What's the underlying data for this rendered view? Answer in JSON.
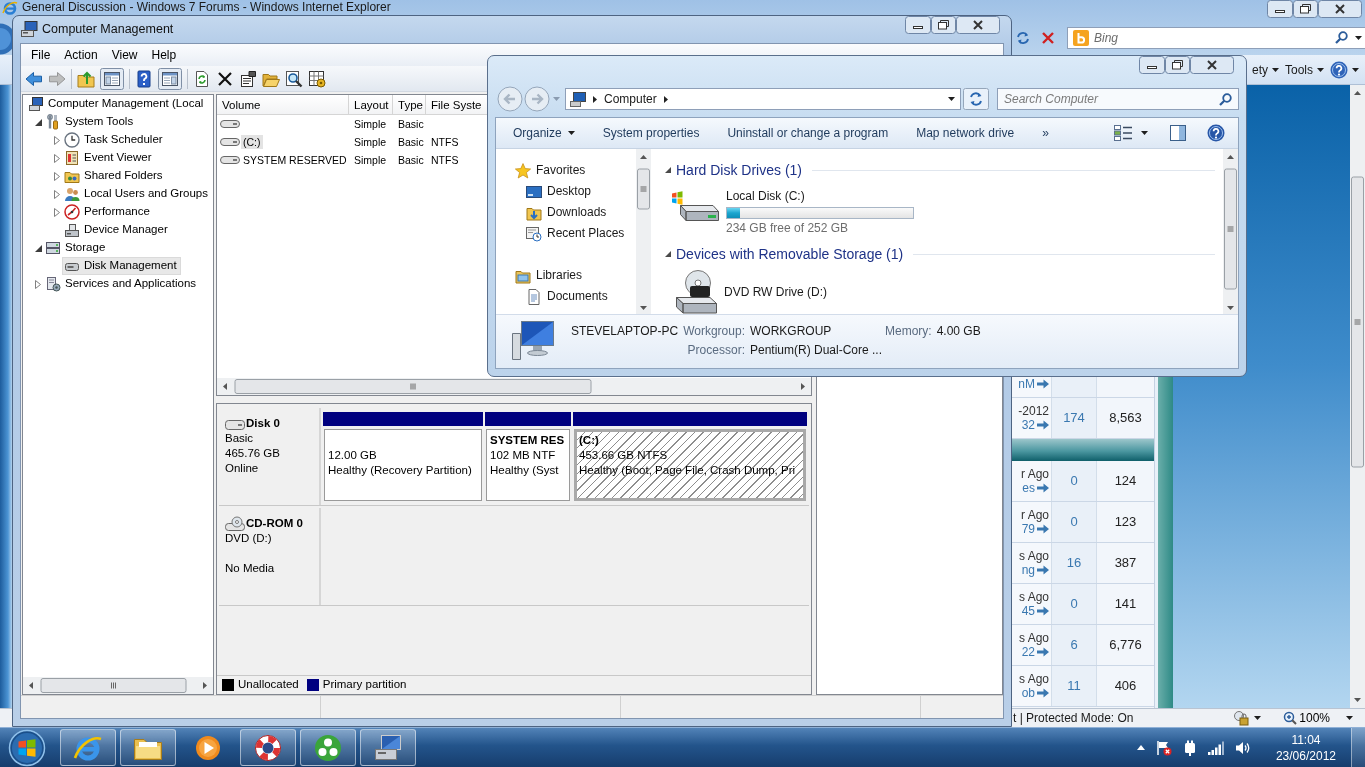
{
  "browser": {
    "title": "General Discussion - Windows 7 Forums - Windows Internet Explorer",
    "search": {
      "placeholder": "Bing"
    },
    "command_bar": [
      {
        "label": "ety",
        "menu": true
      },
      {
        "label": "Tools",
        "menu": true
      }
    ],
    "forum_rows": [
      {
        "kind": "thread",
        "column_1": [
          "nM"
        ]
      },
      {
        "kind": "thread",
        "column_1": [
          "-2012",
          "32"
        ],
        "column_2": "174",
        "column_3": "8,563"
      },
      {
        "kind": "section"
      },
      {
        "kind": "thread",
        "column_1": [
          "r Ago",
          "es"
        ],
        "column_2": "0",
        "column_3": "124"
      },
      {
        "kind": "thread",
        "column_1": [
          "r Ago",
          "79"
        ],
        "column_2": "0",
        "column_3": "123"
      },
      {
        "kind": "thread",
        "column_1": [
          "s Ago",
          "ng"
        ],
        "column_2": "16",
        "column_3": "387"
      },
      {
        "kind": "thread",
        "column_1": [
          "s Ago",
          "45"
        ],
        "column_2": "0",
        "column_3": "141"
      },
      {
        "kind": "thread",
        "column_1": [
          "s Ago",
          "22"
        ],
        "column_2": "6",
        "column_3": "6,776"
      },
      {
        "kind": "thread",
        "column_1": [
          "s Ago",
          "ob"
        ],
        "column_2": "11",
        "column_3": "406"
      }
    ],
    "status_bar": {
      "text": "t | Protected Mode: On",
      "zoom": "100%"
    }
  },
  "computer_management": {
    "title": "Computer Management",
    "menu": [
      "File",
      "Action",
      "View",
      "Help"
    ],
    "toolbar": [
      [
        {
          "pressed": false,
          "disabled": false
        },
        {
          "pressed": false,
          "disabled": true
        }
      ],
      [
        {
          "pressed": false,
          "disabled": false
        },
        {
          "pressed": true,
          "disabled": false
        }
      ],
      [
        {
          "pressed": false,
          "disabled": false
        },
        {
          "pressed": true,
          "disabled": false
        }
      ],
      [
        {
          "pressed": false,
          "disabled": false
        },
        {
          "pressed": false,
          "disabled": false
        },
        {
          "pressed": false,
          "disabled": false
        },
        {
          "pressed": false,
          "disabled": false
        },
        {
          "pressed": false,
          "disabled": false
        },
        {
          "pressed": false,
          "disabled": false
        }
      ]
    ],
    "tree": [
      {
        "label": "Computer Management (Local",
        "selected": false,
        "children": [
          {
            "label": "System Tools",
            "expanded": true,
            "selected": false,
            "children": [
              {
                "label": "Task Scheduler",
                "expanded": false,
                "selected": false
              },
              {
                "label": "Event Viewer",
                "expanded": false,
                "selected": false
              },
              {
                "label": "Shared Folders",
                "expanded": false,
                "selected": false
              },
              {
                "label": "Local Users and Groups",
                "expanded": false,
                "selected": false
              },
              {
                "label": "Performance",
                "expanded": false,
                "selected": false
              },
              {
                "label": "Device Manager",
                "selected": false
              }
            ]
          },
          {
            "label": "Storage",
            "expanded": true,
            "selected": false,
            "children": [
              {
                "label": "Disk Management",
                "selected": true
              }
            ]
          },
          {
            "label": "Services and Applications",
            "expanded": false,
            "selected": false
          }
        ]
      }
    ],
    "volume_list": {
      "columns": [
        "Volume",
        "Layout",
        "Type",
        "File Syste"
      ],
      "rows": [
        {
          "layout": "Simple",
          "type": "Basic",
          "selected": false
        },
        {
          "volume": "(C:)",
          "layout": "Simple",
          "type": "Basic",
          "file_system": "NTFS",
          "selected": true
        },
        {
          "volume": "SYSTEM RESERVED",
          "layout": "Simple",
          "type": "Basic",
          "file_system": "NTFS",
          "selected": false
        }
      ]
    },
    "disks": [
      {
        "kind": "disk",
        "name": "Disk 0",
        "type": "Basic",
        "size": "465.76 GB",
        "status": "Online",
        "partitions": [
          {
            "kind": "primary",
            "lines": [
              "12.00 GB",
              "Healthy (Recovery Partition)"
            ],
            "selected": false
          },
          {
            "kind": "primary",
            "name": "SYSTEM RES",
            "lines": [
              "102 MB NTF",
              "Healthy (Syst"
            ],
            "selected": false
          },
          {
            "kind": "primary",
            "name": "(C:)",
            "lines": [
              "453.66 GB NTFS",
              "Healthy (Boot, Page File, Crash Dump, Pri"
            ],
            "selected": true
          }
        ]
      },
      {
        "kind": "cdrom",
        "name": "CD-ROM 0",
        "type": "DVD (D:)",
        "status": "No Media"
      }
    ],
    "legend": [
      {
        "label": "Unallocated",
        "color": "#000000"
      },
      {
        "label": "Primary partition",
        "color": "#000080"
      }
    ]
  },
  "explorer": {
    "navigation": [
      {
        "disabled": true
      },
      {
        "disabled": true
      }
    ],
    "address": [
      "Computer"
    ],
    "search": {
      "placeholder": "Search Computer"
    },
    "toolbar": [
      {
        "label": "Organize",
        "menu": true
      },
      {
        "label": "System properties",
        "menu": false
      },
      {
        "label": "Uninstall or change a program",
        "menu": false
      },
      {
        "label": "Map network drive",
        "menu": false
      },
      {
        "label": "»",
        "menu": false
      }
    ],
    "nav_pane": [
      {
        "label": "Favorites",
        "children": [
          {
            "label": "Desktop"
          },
          {
            "label": "Downloads"
          },
          {
            "label": "Recent Places"
          }
        ]
      },
      {
        "label": "Libraries",
        "children": [
          {
            "label": "Documents"
          }
        ]
      }
    ],
    "groups": [
      {
        "title": "Hard Disk Drives (1)",
        "expanded": true,
        "items": [
          {
            "kind": "hard_disk",
            "name": "Local Disk (C:)",
            "level": 0.07,
            "caption": "234 GB free of 252 GB"
          }
        ]
      },
      {
        "title": "Devices with Removable Storage (1)",
        "expanded": true,
        "items": [
          {
            "kind": "dvd",
            "name": "DVD RW Drive (D:)"
          }
        ]
      }
    ],
    "details": {
      "name": "STEVELAPTOP-PC",
      "fields": [
        {
          "label": "Workgroup:",
          "value": "WORKGROUP"
        },
        {
          "label": "Memory:",
          "value": "4.00 GB"
        },
        {
          "label": "Processor:",
          "value": "Pentium(R) Dual-Core ..."
        }
      ]
    }
  },
  "taskbar": {
    "items": [
      {
        "running": true
      },
      {
        "running": true
      },
      {
        "running": false
      },
      {
        "running": true
      },
      {
        "running": true
      },
      {
        "running": true
      }
    ],
    "clock": {
      "time": "11:04",
      "date": "23/06/2012"
    }
  }
}
